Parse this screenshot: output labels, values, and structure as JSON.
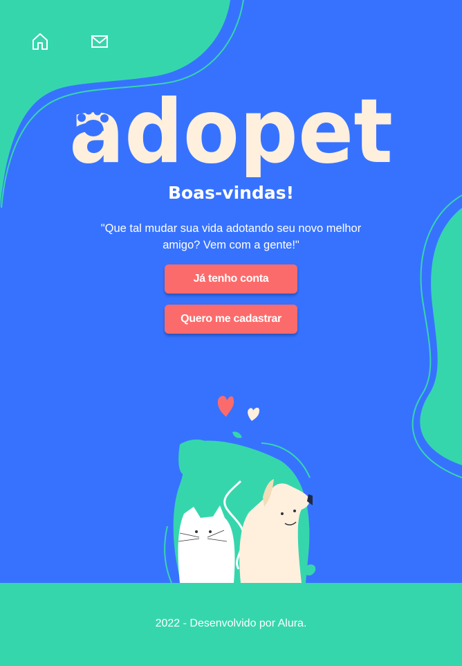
{
  "colors": {
    "background": "#3772FF",
    "accent_green": "#36D6AD",
    "button": "#FC6B6B",
    "logo_cream": "#FFF0DE",
    "text": "#FFFFFF"
  },
  "nav": {
    "home_icon": "home-icon",
    "mail_icon": "mail-icon"
  },
  "logo": {
    "text": "adopet",
    "paw_icon": "paw-icon"
  },
  "hero": {
    "title": "Boas-vindas!",
    "tagline": "\"Que tal mudar sua vida adotando seu novo melhor amigo? Vem com a gente!\""
  },
  "buttons": {
    "login": "Já tenho conta",
    "signup": "Quero me cadastrar"
  },
  "footer": {
    "text": "2022 - Desenvolvido por Alura."
  }
}
